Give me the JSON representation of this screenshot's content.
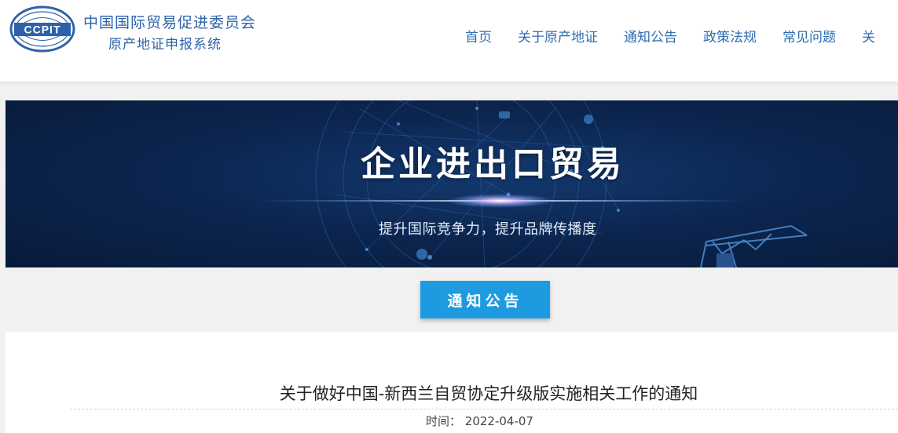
{
  "header": {
    "logo_text": "CCPIT",
    "org_name": "中国国际贸易促进委员会",
    "system_name": "原产地证申报系统",
    "nav": [
      "首页",
      "关于原产地证",
      "通知公告",
      "政策法规",
      "常见问题",
      "关"
    ]
  },
  "banner": {
    "title": "企业进出口贸易",
    "subtitle": "提升国际竞争力，提升品牌传播度"
  },
  "section": {
    "button_label": "通知公告"
  },
  "article": {
    "title": "关于做好中国-新西兰自贸协定升级版实施相关工作的通知",
    "date_label": "时间：",
    "date": "2022-04-07"
  },
  "colors": {
    "brand": "#2e62a8",
    "nav": "#2f6db0",
    "button": "#1e9be0",
    "banner_bg": "#0c2650"
  }
}
